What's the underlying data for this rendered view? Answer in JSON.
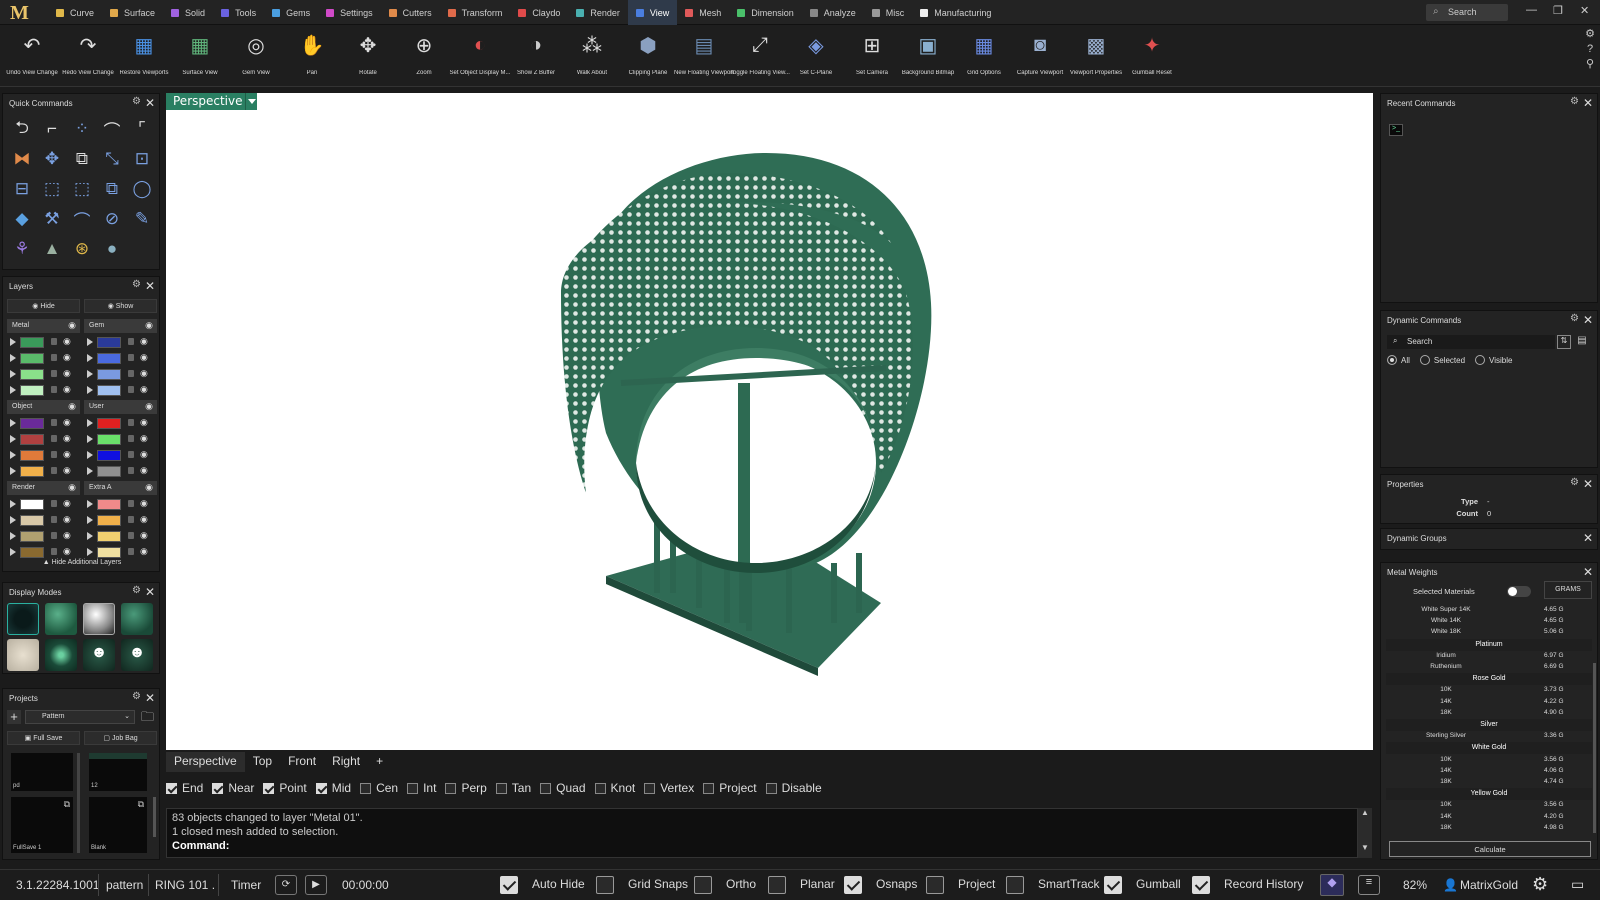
{
  "app": {
    "logo": "M"
  },
  "menu": {
    "tabs": [
      {
        "label": "Curve",
        "color": "#e0b84a"
      },
      {
        "label": "Surface",
        "color": "#e0a84a"
      },
      {
        "label": "Solid",
        "color": "#a062e0"
      },
      {
        "label": "Tools",
        "color": "#6a62e0"
      },
      {
        "label": "Gems",
        "color": "#4a9ee0"
      },
      {
        "label": "Settings",
        "color": "#d04ac8"
      },
      {
        "label": "Cutters",
        "color": "#e08a4a"
      },
      {
        "label": "Transform",
        "color": "#e06a4a"
      },
      {
        "label": "Claydo",
        "color": "#e04a4a"
      },
      {
        "label": "Render",
        "color": "#4ab0b0"
      },
      {
        "label": "View",
        "color": "#4a7ee0"
      },
      {
        "label": "Mesh",
        "color": "#e05a5a"
      },
      {
        "label": "Dimension",
        "color": "#4ac06a"
      },
      {
        "label": "Analyze",
        "color": "#888888"
      },
      {
        "label": "Misc",
        "color": "#999999"
      },
      {
        "label": "Manufacturing",
        "color": "#eeeeee"
      }
    ],
    "active": "View",
    "search_label": "Search"
  },
  "toolbar": {
    "tools": [
      {
        "label": "Undo View Change",
        "icon": "↶",
        "color": "#dddddd"
      },
      {
        "label": "Redo View Change",
        "icon": "↷",
        "color": "#dddddd"
      },
      {
        "label": "Restore Viewports",
        "icon": "▦",
        "color": "#4a90e2"
      },
      {
        "label": "Surface View",
        "icon": "▦",
        "color": "#5fb37a"
      },
      {
        "label": "Gem View",
        "icon": "◎",
        "color": "#dddddd"
      },
      {
        "label": "Pan",
        "icon": "✋",
        "color": "#dddddd"
      },
      {
        "label": "Rotate",
        "icon": "✥",
        "color": "#dddddd"
      },
      {
        "label": "Zoom",
        "icon": "⊕",
        "color": "#dddddd"
      },
      {
        "label": "Set Object Display M...",
        "icon": "◐",
        "color": "#e05050"
      },
      {
        "label": "Show Z Buffer",
        "icon": "◑",
        "color": "#cccccc"
      },
      {
        "label": "Walk About",
        "icon": "⁂",
        "color": "#dddddd"
      },
      {
        "label": "Clipping Plane",
        "icon": "⬢",
        "color": "#8aa0c0"
      },
      {
        "label": "New Floating Viewport",
        "icon": "▤",
        "color": "#6a8ab0"
      },
      {
        "label": "Toggle Floating View...",
        "icon": "⤢",
        "color": "#dddddd"
      },
      {
        "label": "Set C-Plane",
        "icon": "◈",
        "color": "#7a9ae0"
      },
      {
        "label": "Set Camera",
        "icon": "⊞",
        "color": "#dddddd"
      },
      {
        "label": "Background Bitmap",
        "icon": "▣",
        "color": "#8ab0d0"
      },
      {
        "label": "Grid Options",
        "icon": "▦",
        "color": "#6a8ae0"
      },
      {
        "label": "Capture Viewport",
        "icon": "◙",
        "color": "#9ab0d0"
      },
      {
        "label": "Viewport Properties",
        "icon": "▩",
        "color": "#9ab0d0"
      },
      {
        "label": "Gumball Reset",
        "icon": "✦",
        "color": "#e05050"
      }
    ]
  },
  "quick_commands": {
    "title": "Quick Commands",
    "icons": [
      {
        "name": "rotate-back-icon",
        "glyph": "⮌",
        "color": "#dddddd"
      },
      {
        "name": "rectangle-icon",
        "glyph": "⌐",
        "color": "#dddddd"
      },
      {
        "name": "points-icon",
        "glyph": "⁘",
        "color": "#7aa0e0"
      },
      {
        "name": "arc-icon",
        "glyph": "⌒",
        "color": "#dddddd"
      },
      {
        "name": "fillet-icon",
        "glyph": "⌜",
        "color": "#dddddd"
      },
      {
        "name": "mirror-icon",
        "glyph": "⧓",
        "color": "#e08a4a"
      },
      {
        "name": "move-icon",
        "glyph": "✥",
        "color": "#7aa0e0"
      },
      {
        "name": "copy-icon",
        "glyph": "⧉",
        "color": "#dddddd"
      },
      {
        "name": "scale-icon",
        "glyph": "⤡",
        "color": "#7aa0e0"
      },
      {
        "name": "scale-box-icon",
        "glyph": "⊡",
        "color": "#7aa0e0"
      },
      {
        "name": "align-icon",
        "glyph": "⊟",
        "color": "#7aa0e0"
      },
      {
        "name": "select-icon",
        "glyph": "⬚",
        "color": "#7aa0e0"
      },
      {
        "name": "window-select-icon",
        "glyph": "⬚",
        "color": "#7aa0e0"
      },
      {
        "name": "boolean-icon",
        "glyph": "⧉",
        "color": "#7aa0e0"
      },
      {
        "name": "circle-icon",
        "glyph": "◯",
        "color": "#7aa0e0"
      },
      {
        "name": "gem-icon",
        "glyph": "◆",
        "color": "#5aa0e0"
      },
      {
        "name": "brush-icon",
        "glyph": "⚒",
        "color": "#7aa0e0"
      },
      {
        "name": "curve-points-icon",
        "glyph": "⌒",
        "color": "#7aa0e0"
      },
      {
        "name": "hide-icon",
        "glyph": "⊘",
        "color": "#7aa0e0"
      },
      {
        "name": "edit-icon",
        "glyph": "✎",
        "color": "#7aa0e0"
      },
      {
        "name": "figure-icon",
        "glyph": "⚘",
        "color": "#9a7ae0"
      },
      {
        "name": "render-scene-icon",
        "glyph": "▲",
        "color": "#9ab0a0"
      },
      {
        "name": "gumball-icon",
        "glyph": "⊛",
        "color": "#e0b84a"
      },
      {
        "name": "sphere-icon",
        "glyph": "●",
        "color": "#8ab0c0"
      }
    ]
  },
  "layers": {
    "title": "Layers",
    "hide": "Hide",
    "show": "Show",
    "groups_left": [
      {
        "name": "Metal",
        "colors": [
          "#3a9a5a",
          "#5aba6a",
          "#8ae08a",
          "#c0f0c0"
        ]
      },
      {
        "name": "Object",
        "colors": [
          "#6a2a9a",
          "#b04040",
          "#e07a3a",
          "#f0b04a"
        ]
      },
      {
        "name": "Render",
        "colors": [
          "#ffffff",
          "#d8c8a8",
          "#b0a070",
          "#8a6a30"
        ]
      }
    ],
    "groups_right": [
      {
        "name": "Gem",
        "colors": [
          "#2a3a9a",
          "#4a6ae0",
          "#7a9ae0",
          "#a0c0f0"
        ]
      },
      {
        "name": "User",
        "colors": [
          "#e02020",
          "#6ae06a",
          "#1010e0",
          "#909090"
        ]
      },
      {
        "name": "Extra A",
        "colors": [
          "#f08a8a",
          "#f0b04a",
          "#f0d070",
          "#f0e0a0"
        ]
      }
    ],
    "footer": "Hide Additional Layers"
  },
  "display_modes": {
    "title": "Display Modes"
  },
  "projects": {
    "title": "Projects",
    "select_value": "Pattern",
    "full_save": "Full Save",
    "job_bag": "Job Bag",
    "thumbs": [
      {
        "label": "pd"
      },
      {
        "label": "12"
      },
      {
        "label": "FullSave 1"
      },
      {
        "label": "Blank"
      }
    ]
  },
  "viewport": {
    "active_tab": "Perspective",
    "tabs": [
      "Perspective",
      "Top",
      "Front",
      "Right"
    ],
    "add": "+"
  },
  "osnaps": [
    {
      "label": "End",
      "on": true
    },
    {
      "label": "Near",
      "on": true
    },
    {
      "label": "Point",
      "on": true
    },
    {
      "label": "Mid",
      "on": true
    },
    {
      "label": "Cen",
      "on": false
    },
    {
      "label": "Int",
      "on": false
    },
    {
      "label": "Perp",
      "on": false
    },
    {
      "label": "Tan",
      "on": false
    },
    {
      "label": "Quad",
      "on": false
    },
    {
      "label": "Knot",
      "on": false
    },
    {
      "label": "Vertex",
      "on": false
    },
    {
      "label": "Project",
      "on": false
    },
    {
      "label": "Disable",
      "on": false
    }
  ],
  "command": {
    "history": [
      "83 objects changed to layer \"Metal 01\".",
      "1 closed mesh added to selection."
    ],
    "prompt": "Command:"
  },
  "right": {
    "recent_title": "Recent Commands",
    "dynamic_title": "Dynamic Commands",
    "dynamic_search": "Search",
    "filters": [
      {
        "label": "All",
        "on": true
      },
      {
        "label": "Selected",
        "on": false
      },
      {
        "label": "Visible",
        "on": false
      }
    ],
    "properties_title": "Properties",
    "props": [
      {
        "k": "Type",
        "v": "-"
      },
      {
        "k": "Count",
        "v": "0"
      }
    ],
    "dyn_groups_title": "Dynamic Groups",
    "metal_title": "Metal Weights",
    "selected_materials": "Selected Materials",
    "unit": "GRAMS",
    "calculate": "Calculate",
    "weights": [
      {
        "type": "row",
        "n": "White Super 14K",
        "v": "4.65 G"
      },
      {
        "type": "row",
        "n": "White 14K",
        "v": "4.65 G"
      },
      {
        "type": "row",
        "n": "White 18K",
        "v": "5.06 G"
      },
      {
        "type": "head",
        "n": "Platinum"
      },
      {
        "type": "row",
        "n": "Iridium",
        "v": "6.97 G"
      },
      {
        "type": "row",
        "n": "Ruthenium",
        "v": "6.69 G"
      },
      {
        "type": "head",
        "n": "Rose Gold"
      },
      {
        "type": "row",
        "n": "10K",
        "v": "3.73 G"
      },
      {
        "type": "row",
        "n": "14K",
        "v": "4.22 G"
      },
      {
        "type": "row",
        "n": "18K",
        "v": "4.90 G"
      },
      {
        "type": "head",
        "n": "Silver"
      },
      {
        "type": "row",
        "n": "Sterling Silver",
        "v": "3.36 G"
      },
      {
        "type": "head",
        "n": "White Gold"
      },
      {
        "type": "row",
        "n": "10K",
        "v": "3.56 G"
      },
      {
        "type": "row",
        "n": "14K",
        "v": "4.06 G"
      },
      {
        "type": "row",
        "n": "18K",
        "v": "4.74 G"
      },
      {
        "type": "head",
        "n": "Yellow Gold"
      },
      {
        "type": "row",
        "n": "10K",
        "v": "3.56 G"
      },
      {
        "type": "row",
        "n": "14K",
        "v": "4.20 G"
      },
      {
        "type": "row",
        "n": "18K",
        "v": "4.98 G"
      }
    ]
  },
  "status": {
    "version": "3.1.22284.1001",
    "layer": "pattern",
    "file": "RING 101 .",
    "timer": "Timer",
    "time": "00:00:00",
    "toggles": [
      {
        "label": "Auto Hide",
        "on": true
      },
      {
        "label": "Grid Snaps",
        "on": false
      },
      {
        "label": "Ortho",
        "on": false
      },
      {
        "label": "Planar",
        "on": false
      },
      {
        "label": "Osnaps",
        "on": true
      },
      {
        "label": "Project",
        "on": false
      },
      {
        "label": "SmartTrack",
        "on": false
      },
      {
        "label": "Gumball",
        "on": true
      },
      {
        "label": "Record History",
        "on": true
      }
    ],
    "zoom": "82%",
    "user": "MatrixGold"
  }
}
